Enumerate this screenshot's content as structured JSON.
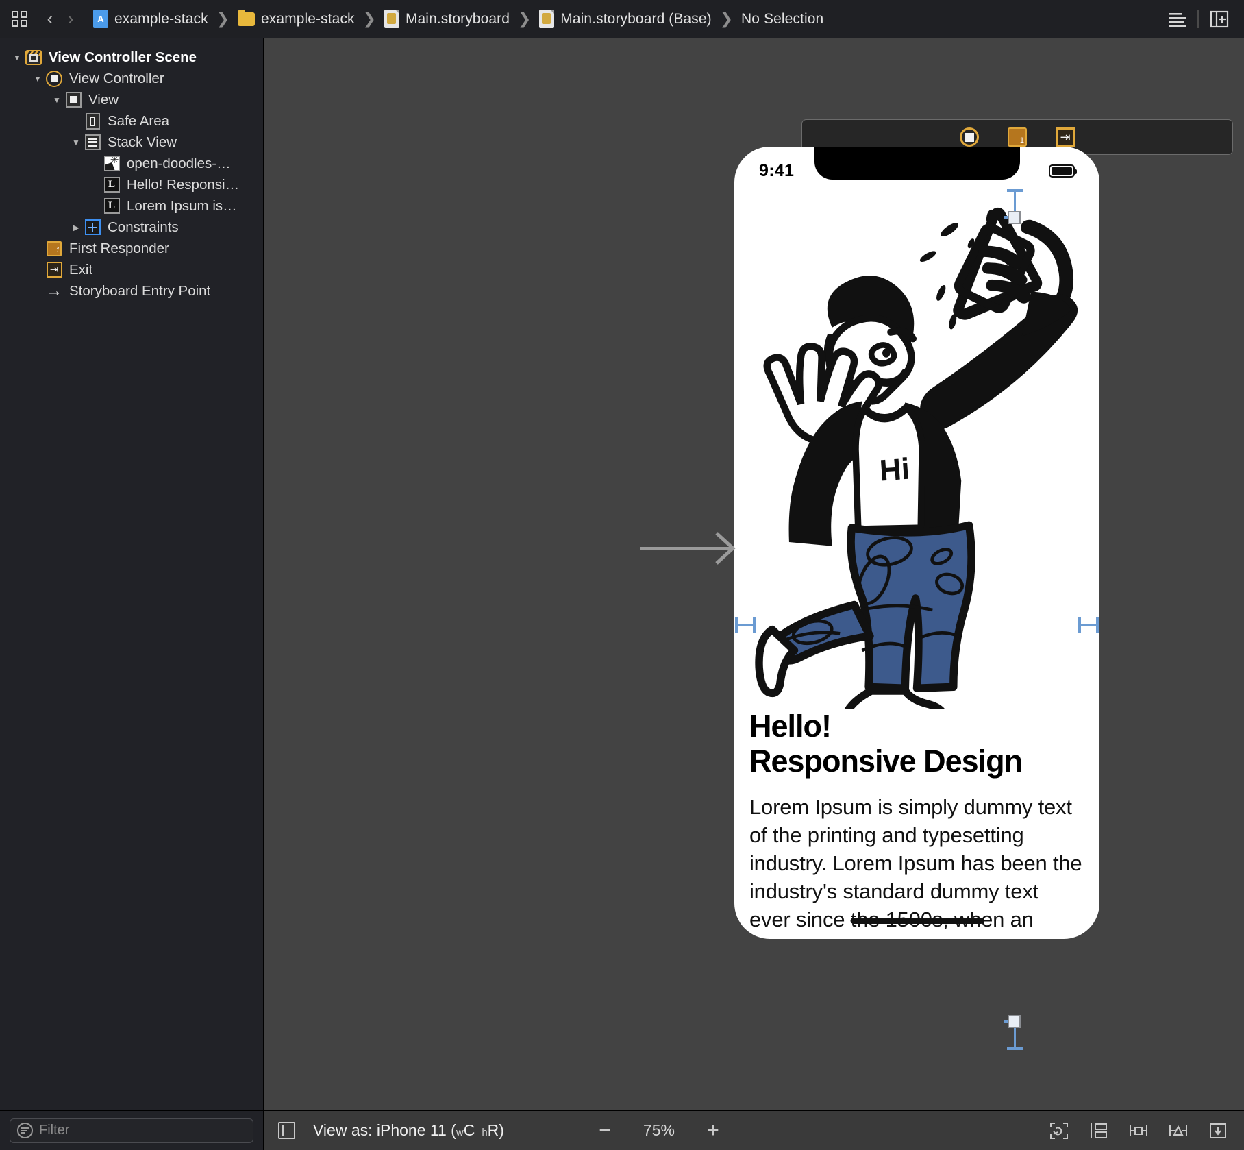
{
  "topbar": {
    "library_icon": "grid-library-icon",
    "back_label": "‹",
    "forward_label": "›",
    "breadcrumbs": [
      {
        "label": "example-stack",
        "icon": "swift-project-icon"
      },
      {
        "label": "example-stack",
        "icon": "folder-icon"
      },
      {
        "label": "Main.storyboard",
        "icon": "storyboard-file-icon"
      },
      {
        "label": "Main.storyboard (Base)",
        "icon": "storyboard-file-icon"
      },
      {
        "label": "No Selection",
        "icon": "none"
      }
    ],
    "separator": "❯",
    "right_buttons": [
      {
        "name": "editor-options-icon"
      },
      {
        "name": "add-editor-icon"
      }
    ]
  },
  "sidebar": {
    "items": [
      {
        "label": "View Controller Scene",
        "icon": "scene-icon",
        "indent": 0,
        "twisty": "down",
        "bold": true
      },
      {
        "label": "View Controller",
        "icon": "view-controller-icon",
        "indent": 1,
        "twisty": "down",
        "bold": false
      },
      {
        "label": "View",
        "icon": "view-icon",
        "indent": 2,
        "twisty": "down",
        "bold": false
      },
      {
        "label": "Safe Area",
        "icon": "safe-area-icon",
        "indent": 3,
        "twisty": "none",
        "bold": false
      },
      {
        "label": "Stack View",
        "icon": "stack-view-icon",
        "indent": 3,
        "twisty": "down",
        "bold": false
      },
      {
        "label": "open-doodles-…",
        "icon": "image-view-icon",
        "indent": 4,
        "twisty": "none",
        "bold": false
      },
      {
        "label": "Hello! Responsi…",
        "icon": "label-icon",
        "indent": 4,
        "twisty": "none",
        "bold": false
      },
      {
        "label": "Lorem Ipsum is…",
        "icon": "label-icon",
        "indent": 4,
        "twisty": "none",
        "bold": false
      },
      {
        "label": "Constraints",
        "icon": "constraints-icon",
        "indent": 3,
        "twisty": "right",
        "bold": false
      },
      {
        "label": "First Responder",
        "icon": "first-responder-icon",
        "indent": 1,
        "twisty": "none",
        "bold": false
      },
      {
        "label": "Exit",
        "icon": "exit-icon",
        "indent": 1,
        "twisty": "none",
        "bold": false
      },
      {
        "label": "Storyboard Entry Point",
        "icon": "entry-point-arrow-icon",
        "indent": 1,
        "twisty": "none",
        "bold": false
      }
    ],
    "filter": {
      "placeholder": "Filter",
      "value": "",
      "icon": "filter-icon"
    }
  },
  "canvas": {
    "scene_toolbar": [
      {
        "name": "view-controller-badge-icon"
      },
      {
        "name": "first-responder-badge-icon"
      },
      {
        "name": "exit-badge-icon"
      }
    ],
    "device": {
      "status_bar": {
        "time": "9:41",
        "battery_icon": "battery-icon"
      },
      "headline_line1": "Hello!",
      "headline_line2": "Responsive Design",
      "body_text": "Lorem Ipsum is simply dummy text of the printing and typesetting industry. Lorem Ipsum has been the industry's standard dummy text ever since the 1500s, when an unknown printer took a galley",
      "image_alt": "open-doodles-illustration",
      "shirt_text": "Hi"
    },
    "colors": {
      "canvas_background": "#434343",
      "sidebar_background": "#212227",
      "accent_orange": "#e0a83a",
      "constraint_blue": "#6b9bd2",
      "jeans_blue": "#3d5a8c"
    }
  },
  "bottombar": {
    "panel_toggle_icon": "show-document-outline-icon",
    "view_as_prefix": "View as: iPhone 11 (",
    "view_as_w": "w",
    "view_as_wval": "C",
    "view_as_h": "h",
    "view_as_hval": "R",
    "view_as_suffix": ")",
    "zoom_out": "−",
    "zoom_value": "75%",
    "zoom_in": "+",
    "right_icons": [
      {
        "name": "update-frames-icon"
      },
      {
        "name": "embed-in-icon"
      },
      {
        "name": "align-icon"
      },
      {
        "name": "add-constraints-icon"
      },
      {
        "name": "resolve-auto-layout-icon"
      }
    ]
  }
}
